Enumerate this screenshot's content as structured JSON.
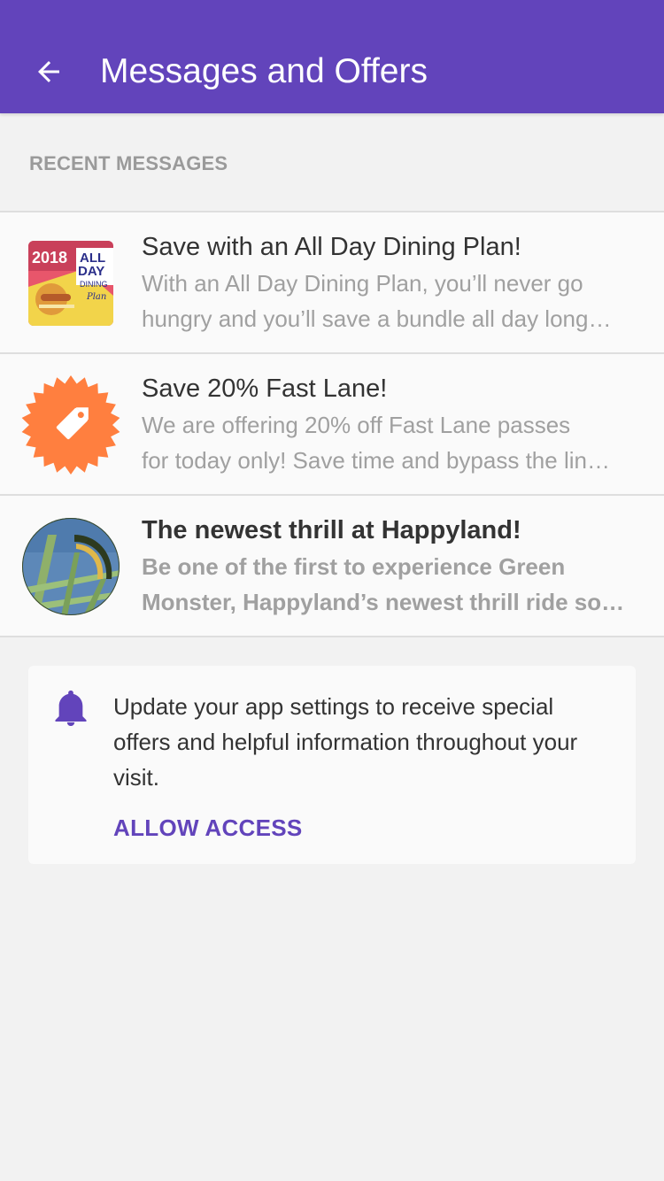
{
  "header": {
    "title": "Messages and Offers",
    "back_icon": "arrow-left-icon",
    "background": "#6244bb"
  },
  "section": {
    "label": "RECENT MESSAGES"
  },
  "messages": [
    {
      "title": "Save with an All Day Dining Plan!",
      "body_line1": "With an All Day Dining Plan, you’ll never go",
      "body_line2": "hungry and you’ll save a bundle all day long…",
      "thumb_year": "2018",
      "thumb_all": "ALL",
      "thumb_day": "DAY",
      "thumb_dining": "DINING",
      "thumb_plan": "Plan",
      "unread": false
    },
    {
      "title": "Save 20% Fast Lane!",
      "body_line1": "We are offering 20% off Fast Lane passes",
      "body_line2": "for today only! Save time and bypass the lin…",
      "icon": "price-tag-icon",
      "icon_color": "#ff7f3f",
      "unread": false
    },
    {
      "title": "The newest thrill at Happyland!",
      "body_line1": "Be one of the first to experience Green",
      "body_line2": "Monster, Happyland’s newest thrill ride so…",
      "unread": true
    }
  ],
  "notice": {
    "text": "Update your app settings to receive special offers and helpful information throughout your visit.",
    "action": "ALLOW ACCESS",
    "icon": "bell-icon",
    "accent": "#6244bb"
  }
}
